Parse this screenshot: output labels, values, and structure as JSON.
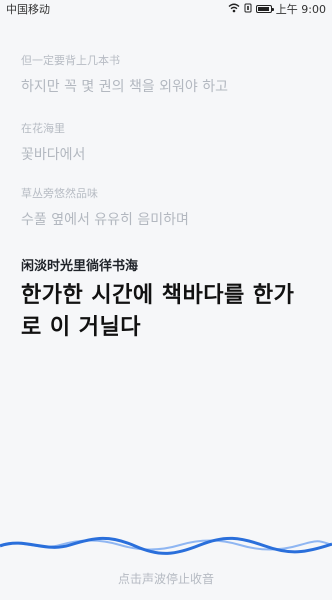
{
  "status_bar": {
    "carrier": "中国移动",
    "time": "上午 9:00",
    "icons": [
      "wifi-icon",
      "alarm-icon",
      "battery-icon"
    ]
  },
  "history": [
    {
      "source": "但一定要背上几本书",
      "translation": "하지만 꼭 몇 권의 책을 외워야 하고"
    },
    {
      "source": "在花海里",
      "translation": "꽃바다에서"
    },
    {
      "source": "草丛旁悠然品味",
      "translation": "수풀 옆에서 유유히 음미하며"
    }
  ],
  "current": {
    "source": "闲淡时光里徜徉书海",
    "translation": "한가한 시간에 책바다를 한가로 이 거닐다"
  },
  "hint": "点击声波停止收音",
  "colors": {
    "background": "#f6f7f9",
    "wave_primary": "#2a6fdb",
    "wave_secondary": "#8fb6f2"
  }
}
